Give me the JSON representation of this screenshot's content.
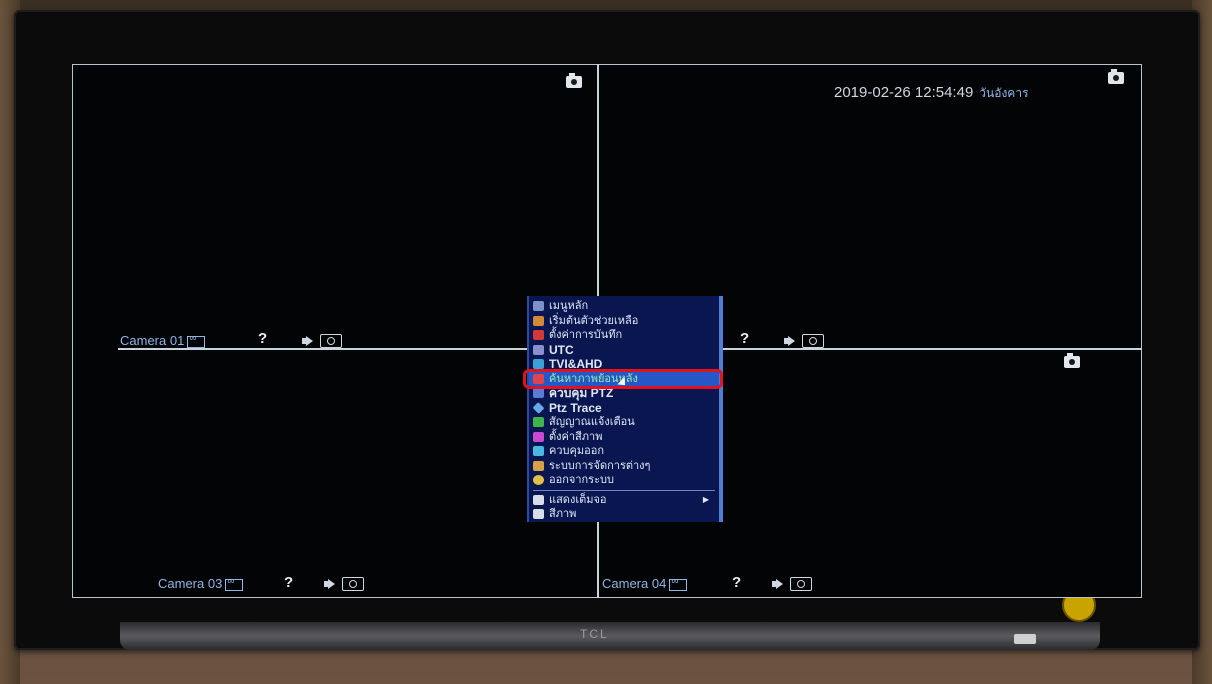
{
  "datetime": {
    "date": "2019-02-26 12:54:49",
    "weekday": "วันอังคาร"
  },
  "cameras": [
    {
      "label": "Camera 01"
    },
    {
      "label": ""
    },
    {
      "label": "Camera 03"
    },
    {
      "label": "Camera 04"
    }
  ],
  "icons": {
    "help": "?"
  },
  "menu": {
    "items": [
      {
        "label": "เมนูหลัก",
        "icon": "main-menu-icon"
      },
      {
        "label": "เริ่มต้นตัวช่วยเหลือ",
        "icon": "wizard-icon"
      },
      {
        "label": "ตั้งค่าการบันทึก",
        "icon": "record-icon"
      },
      {
        "label": "UTC",
        "icon": "utc-icon"
      },
      {
        "label": "TVI&AHD",
        "icon": "tvi-ahd-icon"
      },
      {
        "label": "ค้นหาภาพย้อนหลัง",
        "icon": "playback-icon"
      },
      {
        "label": "ควบคุม PTZ",
        "icon": "ptz-icon"
      },
      {
        "label": "Ptz Trace",
        "icon": "ptz-trace-icon"
      },
      {
        "label": "สัญญาณแจ้งเตือน",
        "icon": "alarm-icon"
      },
      {
        "label": "ตั้งค่าสีภาพ",
        "icon": "color-icon"
      },
      {
        "label": "ควบคุมออก",
        "icon": "output-icon"
      },
      {
        "label": "ระบบการจัดการต่างๆ",
        "icon": "manage-icon"
      },
      {
        "label": "ออกจากระบบ",
        "icon": "logout-icon"
      }
    ],
    "extra": [
      {
        "label": "แสดงเต็มจอ",
        "icon": "fullscreen-icon"
      },
      {
        "label": "สีภาพ",
        "icon": "split-icon"
      }
    ],
    "active_index": 5
  },
  "tv": {
    "brand": "TCL"
  },
  "colors": {
    "menu_bg": "#0a1650",
    "menu_active": "#2656c8",
    "highlight": "#e0141e"
  }
}
